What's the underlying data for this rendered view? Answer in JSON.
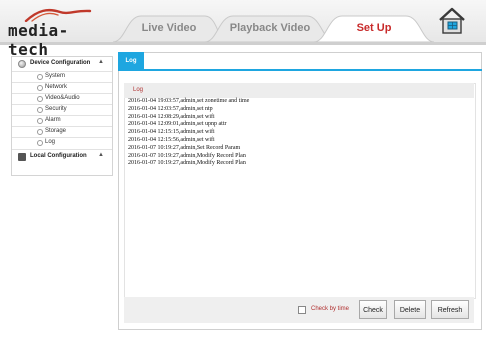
{
  "header": {
    "logo_text": "media-tech",
    "tabs": {
      "live": "Live Video",
      "playback": "Playback Video",
      "setup": "Set Up"
    }
  },
  "sidebar": {
    "device_configuration": "Device Configuration",
    "items": [
      "System",
      "Network",
      "Video&Audio",
      "Security",
      "Alarm",
      "Storage",
      "Log"
    ],
    "local_configuration": "Local Configuration"
  },
  "content": {
    "tab_label": "Log",
    "log_title": "Log",
    "lines": [
      "2016-01-04 19:03:57,admin,set zonetime and time",
      "2016-01-04 12:03:57,admin,set ntp",
      "2016-01-04 12:08:29,admin,set wifi",
      "2016-01-04 12:09:01,admin,set upnp attr",
      "2016-01-04 12:15:15,admin,set wifi",
      "2016-01-04 12:15:56,admin,set wifi",
      "2016-01-07 10:19:27,admin,Set Record Param",
      "2016-01-07 10:19:27,admin,Modify Record Plan",
      "2016-01-07 10:19:27,admin,Modify Record Plan"
    ],
    "check_by_time": "Check by time",
    "buttons": {
      "check": "Check",
      "delete": "Delete",
      "refresh": "Refresh"
    }
  },
  "colors": {
    "accent_blue": "#1ea6e0",
    "active_tab_red": "#c82a2a",
    "log_title_red": "#b03030"
  }
}
